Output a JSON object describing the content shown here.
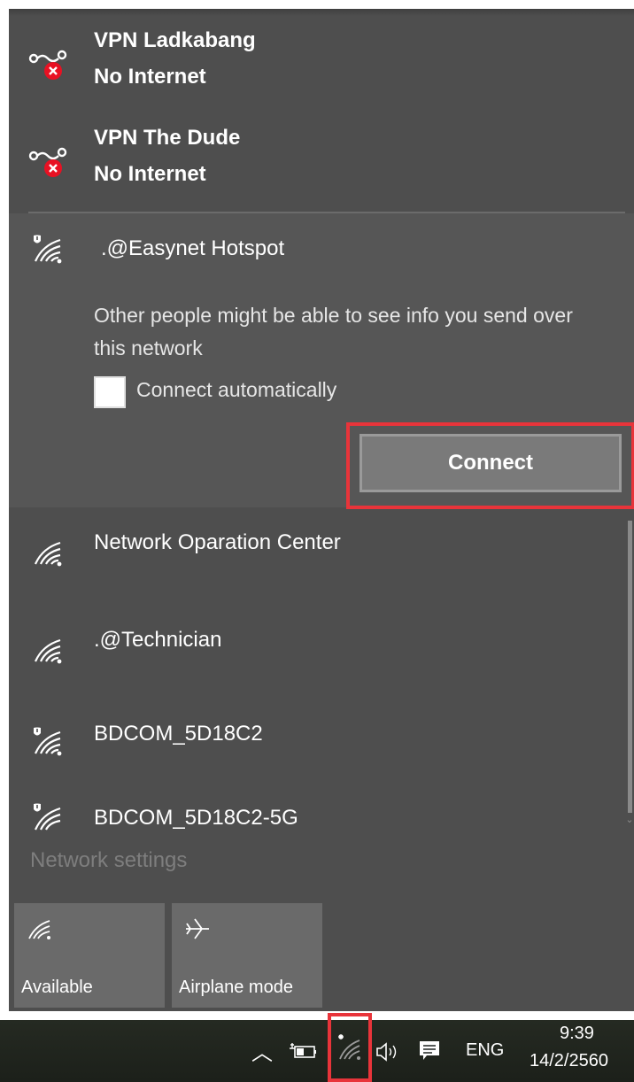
{
  "vpn_connections": [
    {
      "name": "VPN Ladkabang",
      "status": "No Internet",
      "icon": "vpn-error-icon"
    },
    {
      "name": "VPN The Dude",
      "status": "No Internet",
      "icon": "vpn-error-icon"
    }
  ],
  "expanded_network": {
    "name": ".@Easynet Hotspot",
    "icon": "wifi-secured-warning-icon",
    "warning": "Other people might be able to see info you send over this network",
    "connect_automatically_label": "Connect automatically",
    "connect_automatically_checked": false,
    "connect_button_label": "Connect"
  },
  "networks": [
    {
      "name": "Network Oparation Center",
      "icon": "wifi-icon"
    },
    {
      "name": ".@Technician",
      "icon": "wifi-icon"
    },
    {
      "name": "BDCOM_5D18C2",
      "icon": "wifi-secured-warning-icon"
    },
    {
      "name": "BDCOM_5D18C2-5G",
      "icon": "wifi-secured-warning-icon"
    }
  ],
  "network_settings_label": "Network settings",
  "quick_actions": [
    {
      "label": "Available",
      "icon": "wifi-icon"
    },
    {
      "label": "Airplane mode",
      "icon": "airplane-icon"
    }
  ],
  "taskbar": {
    "language": "ENG",
    "time": "9:39",
    "date": "14/2/2560"
  },
  "colors": {
    "flyout_bg": "#4e4e4e",
    "expanded_bg": "#565656",
    "highlight_red": "#e8343a",
    "tile_bg": "#6a6a6a"
  }
}
